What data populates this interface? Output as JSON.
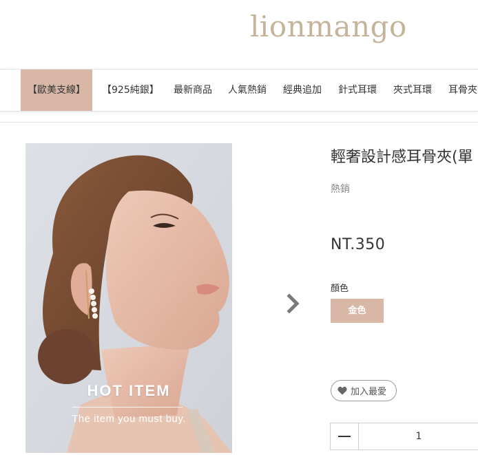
{
  "header": {
    "logo_text": "lionmango",
    "logo_color": "#c4b49a"
  },
  "nav": {
    "items": [
      {
        "label": "【歐美支線】",
        "active": true
      },
      {
        "label": "【925純銀】"
      },
      {
        "label": "最新商品"
      },
      {
        "label": "人氣熱銷"
      },
      {
        "label": "經典追加"
      },
      {
        "label": "針式耳環"
      },
      {
        "label": "夾式耳環"
      },
      {
        "label": "耳骨夾"
      }
    ],
    "active_color": "#d8b7a7"
  },
  "product": {
    "image": {
      "hot_title": "HOT ITEM",
      "hot_subtitle": "The item you must buy."
    },
    "title": "輕奢設計感耳骨夾(單",
    "tag": "熱銷",
    "price": "NT.350",
    "color_label": "顏色",
    "color_option": "金色",
    "favorite_label": "加入最愛",
    "quantity": "1"
  }
}
